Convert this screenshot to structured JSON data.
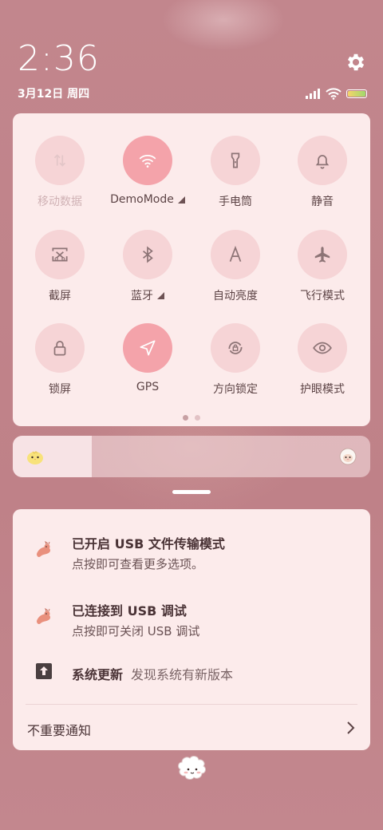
{
  "status": {
    "time": "2:36",
    "date": "3月12日 周四",
    "icons": [
      "signal-icon",
      "wifi-icon",
      "battery-icon"
    ],
    "settings_icon": "gear-icon"
  },
  "quick_settings": {
    "tiles": [
      {
        "label": "移动数据",
        "icon": "mobile-data-icon",
        "active": false,
        "disabled": true,
        "has_more": false
      },
      {
        "label": "DemoMode",
        "icon": "wifi-icon",
        "active": true,
        "disabled": false,
        "has_more": true
      },
      {
        "label": "手电筒",
        "icon": "flashlight-icon",
        "active": false,
        "disabled": false,
        "has_more": false
      },
      {
        "label": "静音",
        "icon": "bell-icon",
        "active": false,
        "disabled": false,
        "has_more": false
      },
      {
        "label": "截屏",
        "icon": "screenshot-icon",
        "active": false,
        "disabled": false,
        "has_more": false
      },
      {
        "label": "蓝牙",
        "icon": "bluetooth-icon",
        "active": false,
        "disabled": false,
        "has_more": true
      },
      {
        "label": "自动亮度",
        "icon": "auto-brightness-icon",
        "active": false,
        "disabled": false,
        "has_more": false
      },
      {
        "label": "飞行模式",
        "icon": "airplane-icon",
        "active": false,
        "disabled": false,
        "has_more": false
      },
      {
        "label": "锁屏",
        "icon": "lock-icon",
        "active": false,
        "disabled": false,
        "has_more": false
      },
      {
        "label": "GPS",
        "icon": "gps-icon",
        "active": true,
        "disabled": false,
        "has_more": false
      },
      {
        "label": "方向锁定",
        "icon": "rotation-lock-icon",
        "active": false,
        "disabled": false,
        "has_more": false
      },
      {
        "label": "护眼模式",
        "icon": "eye-icon",
        "active": false,
        "disabled": false,
        "has_more": false
      }
    ],
    "page_count": 2,
    "current_page": 1
  },
  "brightness": {
    "level": 0.22,
    "min_icon": "chick-icon",
    "max_icon": "sheep-icon"
  },
  "notifications": [
    {
      "title": "已开启 USB 文件传输模式",
      "subtitle": "点按即可查看更多选项。",
      "icon": "usb-cat-icon"
    },
    {
      "title": "已连接到 USB 调试",
      "subtitle": "点按即可关闭 USB 调试",
      "icon": "usb-cat-icon"
    },
    {
      "title": "系统更新",
      "subtitle": "发现系统有新版本",
      "icon": "update-arrow-icon"
    }
  ],
  "unimportant": {
    "label": "不重要通知",
    "icon": "chevron-right-icon"
  },
  "colors": {
    "background": "#c0848b",
    "panel": "#fcebeb",
    "tile": "#f6d4d6",
    "tile_active": "#f4a3aa",
    "text": "#5d4446"
  }
}
